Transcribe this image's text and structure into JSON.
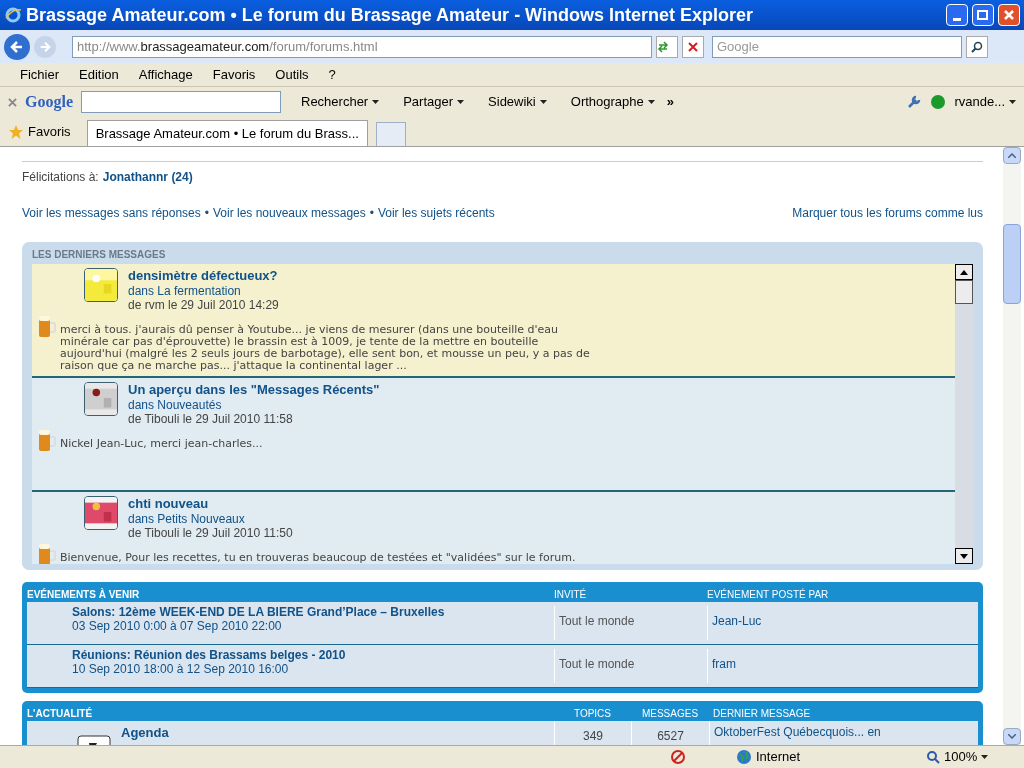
{
  "window": {
    "title": "Brassage Amateur.com • Le forum du Brassage Amateur - Windows Internet Explorer"
  },
  "address": {
    "prefix": "http://www.",
    "domain": "brassageamateur.com",
    "path": "/forum/forums.html"
  },
  "search": {
    "placeholder": "Google"
  },
  "menu": [
    "Fichier",
    "Edition",
    "Affichage",
    "Favoris",
    "Outils",
    "?"
  ],
  "google_toolbar": {
    "logo": "Google",
    "buttons": [
      "Rechercher",
      "Partager",
      "Sidewiki",
      "Orthographe"
    ],
    "more": "»",
    "account": "rvande..."
  },
  "favorites": "Favoris",
  "tabs": [
    {
      "label": "Brassage Amateur.com • Le forum du Brass...",
      "selected": true
    }
  ],
  "birthday": {
    "label": "Félicitations à:",
    "user": "Jonathannr (24)"
  },
  "link_separator": "•",
  "links": [
    "Voir les messages sans réponses",
    "Voir les nouveaux messages",
    "Voir les sujets récents"
  ],
  "mark_read": "Marquer tous les forums comme lus",
  "latest": {
    "title": "LES DERNIERS MESSAGES",
    "messages": [
      {
        "highlighted": true,
        "title": "densimètre défectueux?",
        "forum": "dans La fermentation",
        "meta": "de rvm le 29 Juil 2010 14:29",
        "excerpt": "merci à tous. j'aurais dû penser à Youtube... je viens de mesurer (dans une bouteille d'eau minérale car pas d'éprouvette) le brassin est à 1009, je tente de la mettre en bouteille aujourd'hui (malgré les 2 seuls jours de barbotage), elle sent bon, et mousse un peu, y a pas de raison que ça ne marche pas... j'attaque la continental lager ..."
      },
      {
        "highlighted": false,
        "title": "Un aperçu dans les \"Messages Récents\"",
        "forum": "dans Nouveautés",
        "meta": "de Tibouli le 29 Juil 2010 11:58",
        "excerpt": "Nickel Jean-Luc, merci jean-charles..."
      },
      {
        "highlighted": false,
        "title": "chti nouveau",
        "forum": "dans Petits Nouveaux",
        "meta": "de Tibouli le 29 Juil 2010 11:50",
        "excerpt": "Bienvenue, Pour les recettes, tu en trouveras beaucoup de testées et \"validées\" sur le forum."
      }
    ]
  },
  "events": {
    "columns": [
      "EVÉNEMENTS À VENIR",
      "INVITÉ",
      "EVÉNEMENT POSTÉ PAR"
    ],
    "rows": [
      {
        "title": "Salons: 12ème WEEK-END DE LA BIERE Grand’Place – Bruxelles",
        "dates": "03 Sep 2010 0:00 à 07 Sep 2010 22:00",
        "guests": "Tout le monde",
        "poster": "Jean-Luc"
      },
      {
        "title": "Réunions: Réunion des Brassams belges - 2010",
        "dates": "10 Sep 2010 18:00 à 12 Sep 2010 16:00",
        "guests": "Tout le monde",
        "poster": "fram"
      }
    ]
  },
  "news": {
    "columns": [
      "L'ACTUALITÉ",
      "TOPICS",
      "MESSAGES",
      "DERNIER MESSAGE"
    ],
    "rows": [
      {
        "title": "Agenda",
        "topics": "349",
        "messages": "6527",
        "last": "OktoberFest Québecquois... en"
      }
    ]
  },
  "status_bar": {
    "zone": "Internet",
    "zoom": "100%"
  }
}
